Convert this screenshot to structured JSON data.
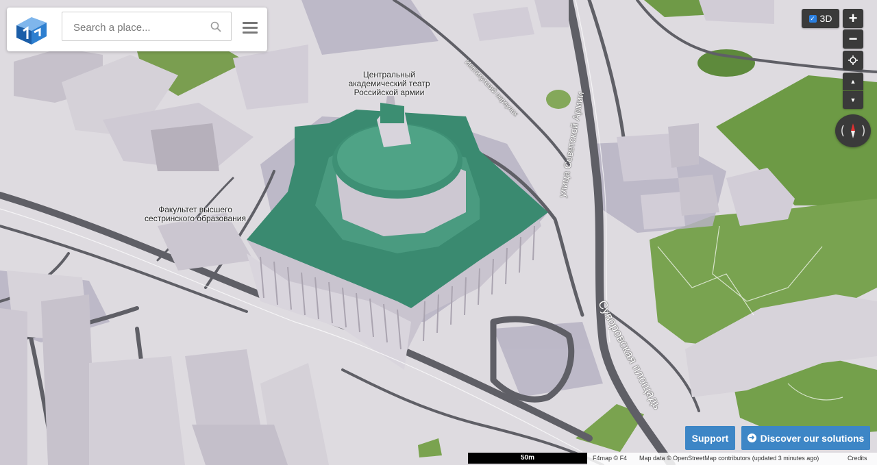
{
  "search": {
    "placeholder": "Search a place..."
  },
  "icons": {
    "logo": "f4map-cube-logo",
    "search": "search-icon",
    "menu": "hamburger-menu-icon",
    "locate": "crosshair-icon",
    "compass": "compass-icon",
    "discover": "arrow-circle-right-icon"
  },
  "controls": {
    "toggle_3d_label": "3D",
    "toggle_3d_checked": true,
    "zoom_in": "+",
    "zoom_out": "−",
    "tilt_up": "▲",
    "tilt_down": "▼"
  },
  "labels": {
    "theatre": "Центральный\nакадемический театр\nРоссийской армии",
    "faculty": "Факультет высшего\nсестринского образования",
    "street_sovetskoy_armii": "улица Советской Армии",
    "suvorovskaya": "Суворовская площадь",
    "institutsky": "Институтский переулок"
  },
  "buttons": {
    "support": "Support",
    "discover": "Discover our solutions"
  },
  "scale": "50m",
  "attribution": {
    "f4map": "F4map © F4",
    "mapdata": "Map data © OpenStreetMap contributors (updated 3 minutes ago)",
    "credits": "Credits"
  },
  "colors": {
    "ground": "#dedbe0",
    "road": "#5f5f66",
    "building": "#c8c3cc",
    "roof_green": "#3e8f76",
    "park": "#6c9a44",
    "button_blue": "#3d86c6",
    "control_dark": "#3a3a3a"
  }
}
